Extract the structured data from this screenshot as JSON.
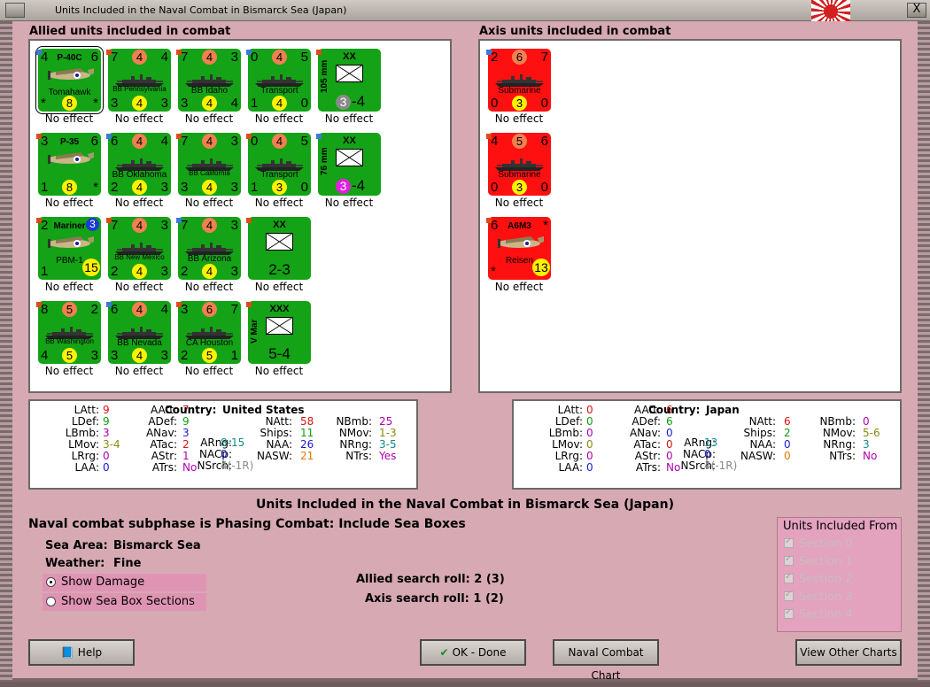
{
  "window": {
    "title": "Units Included in the Naval Combat in Bismarck Sea (Japan)",
    "close_label": "X"
  },
  "allied": {
    "heading": "Allied units included in combat"
  },
  "axis": {
    "heading": "Axis units included in combat"
  },
  "effect_text": "No effect",
  "allied_units": [
    {
      "type": "air",
      "tl": "4",
      "tr": "6",
      "bl": "*",
      "br": "*",
      "top": "P-40C",
      "bottom": "Tomahawk",
      "circle": "8",
      "selected": true
    },
    {
      "type": "ship",
      "tl": "7",
      "topc": "4",
      "tr": "4",
      "bl": "3",
      "botc": "4",
      "br": "3",
      "name": "BB Pennsylvania"
    },
    {
      "type": "ship",
      "tl": "7",
      "topc": "4",
      "tr": "3",
      "bl": "3",
      "botc": "4",
      "br": "4",
      "name": "BB Idaho"
    },
    {
      "type": "ship",
      "tl": "0",
      "topc": "4",
      "tr": "5",
      "bl": "1",
      "botc": "4",
      "br": "0",
      "name": "Transport"
    },
    {
      "type": "land",
      "unit": "XX",
      "vert": "105 mm",
      "str": "-4",
      "att": "3",
      "att_color": "#8a8a8a"
    },
    {
      "type": "air",
      "tl": "3",
      "tr": "6",
      "bl": "1",
      "br": "*",
      "top": "P-35",
      "bottom": "",
      "circle": "8"
    },
    {
      "type": "ship",
      "tl": "6",
      "topc": "4",
      "tr": "4",
      "bl": "2",
      "botc": "4",
      "br": "3",
      "name": "BB Oklahoma"
    },
    {
      "type": "ship",
      "tl": "7",
      "topc": "4",
      "tr": "3",
      "bl": "3",
      "botc": "4",
      "br": "3",
      "name": "BB California"
    },
    {
      "type": "ship",
      "tl": "0",
      "topc": "4",
      "tr": "5",
      "bl": "1",
      "botc": "3",
      "br": "0",
      "name": "Transport"
    },
    {
      "type": "land",
      "unit": "XX",
      "vert": "76 mm",
      "str": "-4",
      "att": "3",
      "att_color": "#e020e0"
    },
    {
      "type": "air",
      "tl": "2",
      "tr": "3",
      "bl": "1",
      "br": "*",
      "top": "Mariner",
      "bottom": "PBM-1",
      "circle": "15",
      "bluec": "3"
    },
    {
      "type": "ship",
      "tl": "7",
      "topc": "4",
      "tr": "3",
      "bl": "2",
      "botc": "4",
      "br": "3",
      "name": "BB New Mexico"
    },
    {
      "type": "ship",
      "tl": "7",
      "topc": "4",
      "tr": "3",
      "bl": "2",
      "botc": "4",
      "br": "3",
      "name": "BB Arizona"
    },
    {
      "type": "land",
      "unit": "XX",
      "vert": "",
      "str": "2-3",
      "att": "",
      "att_color": ""
    },
    {
      "type": "ship",
      "tl": "8",
      "topc": "5",
      "tr": "2",
      "bl": "4",
      "botc": "5",
      "br": "3",
      "name": "BB Washington"
    },
    {
      "type": "ship",
      "tl": "6",
      "topc": "4",
      "tr": "4",
      "bl": "3",
      "botc": "4",
      "br": "3",
      "name": "BB Nevada"
    },
    {
      "type": "ship",
      "tl": "3",
      "topc": "6",
      "tr": "7",
      "bl": "2",
      "botc": "5",
      "br": "1",
      "name": "CA Houston"
    },
    {
      "type": "land",
      "unit": "XXX",
      "vert": "V Mar",
      "str": "5-4",
      "att": "",
      "att_color": ""
    }
  ],
  "axis_units": [
    {
      "type": "ship",
      "tl": "2",
      "topc": "6",
      "tr": "7",
      "bl": "0",
      "botc": "3",
      "br": "0",
      "name": "Submarine"
    },
    {
      "type": "ship",
      "tl": "4",
      "topc": "5",
      "tr": "6",
      "bl": "0",
      "botc": "3",
      "br": "0",
      "name": "Submarine"
    },
    {
      "type": "air",
      "tl": "6",
      "tr": "*",
      "bl": "*",
      "br": "*",
      "top": "A6M3",
      "bottom": "Reisen",
      "circle": "13"
    }
  ],
  "allied_stats": {
    "latt": "9",
    "ldef": "9",
    "lbmb": "3",
    "lmov": "3-4",
    "lrrg": "0",
    "laa": "0",
    "aatt": "7",
    "adef": "9",
    "anav": "3",
    "atac": "2",
    "astr": "1",
    "atrs": "No",
    "country": "United States",
    "arng": "8-15",
    "nacp": "0",
    "nsrch": "4(-1R)",
    "natt": "58",
    "ships": "11",
    "naa": "26",
    "nasw": "21",
    "nbmb": "25",
    "nmov": "1-3",
    "nrng": "3-5",
    "ntrs": "Yes"
  },
  "axis_stats": {
    "latt": "0",
    "ldef": "0",
    "lbmb": "0",
    "lmov": "0",
    "lrrg": "0",
    "laa": "0",
    "aatt": "6",
    "adef": "6",
    "anav": "0",
    "atac": "0",
    "astr": "0",
    "atrs": "No",
    "country": "Japan",
    "arng": "13",
    "nacp": "0",
    "nsrch": "4(-1R)",
    "natt": "6",
    "ships": "2",
    "naa": "0",
    "nasw": "0",
    "nbmb": "0",
    "nmov": "5-6",
    "nrng": "3",
    "ntrs": "No"
  },
  "labels": {
    "latt": "LAtt:",
    "ldef": "LDef:",
    "lbmb": "LBmb:",
    "lmov": "LMov:",
    "lrrg": "LRrg:",
    "laa": "LAA:",
    "aatt": "AAtt:",
    "adef": "ADef:",
    "anav": "ANav:",
    "atac": "ATac:",
    "astr": "AStr:",
    "atrs": "ATrs:",
    "country": "Country:",
    "arng": "ARng:",
    "nacp": "NACp:",
    "nsrch": "NSrch:",
    "natt": "NAtt:",
    "ships": "Ships:",
    "naa": "NAA:",
    "nasw": "NASW:",
    "nbmb": "NBmb:",
    "nmov": "NMov:",
    "nrng": "NRng:",
    "ntrs": "NTrs:"
  },
  "main": {
    "title": "Units Included in the Naval Combat in Bismarck Sea (Japan)",
    "subtitle": "Naval combat subphase is Phasing Combat: Include Sea Boxes",
    "sea_area_label": "Sea Area:",
    "sea_area": "Bismarck Sea",
    "weather_label": "Weather:",
    "weather": "Fine",
    "show_damage": "Show Damage",
    "show_sections": "Show Sea Box Sections",
    "allied_search": "Allied search roll: 2 (3)",
    "axis_search": "Axis search roll: 1 (2)"
  },
  "sections": {
    "heading": "Units Included From",
    "items": [
      "Section 0",
      "Section 1",
      "Section 2",
      "Section 3",
      "Section 4"
    ]
  },
  "buttons": {
    "help": "Help",
    "ok": "OK - Done",
    "naval_chart": "Naval Combat Chart",
    "other_charts": "View Other Charts"
  },
  "colors": {
    "counter_green": "#14a216",
    "counter_red": "#ff1010",
    "background": "#d6a9b3"
  }
}
